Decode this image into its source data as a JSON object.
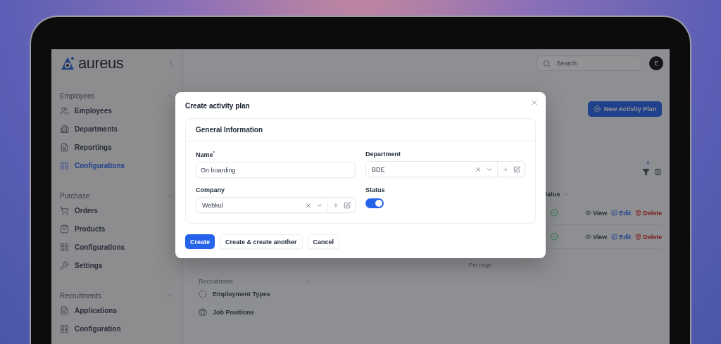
{
  "app": {
    "logo": "aureus",
    "search_placeholder": "Search",
    "avatar": "E"
  },
  "sidebar": {
    "groups": [
      {
        "title": "Employees",
        "expanded": true,
        "items": [
          {
            "label": "Employees",
            "selected": false
          },
          {
            "label": "Departments",
            "selected": false
          },
          {
            "label": "Reportings",
            "selected": false
          },
          {
            "label": "Configurations",
            "selected": true
          }
        ]
      },
      {
        "title": "Purchase",
        "expanded": true,
        "items": [
          {
            "label": "Orders",
            "selected": false
          },
          {
            "label": "Products",
            "selected": false
          },
          {
            "label": "Configurations",
            "selected": false
          },
          {
            "label": "Settings",
            "selected": false
          }
        ]
      },
      {
        "title": "Recruitments",
        "expanded": true,
        "items": [
          {
            "label": "Applications",
            "selected": false
          },
          {
            "label": "Configuration",
            "selected": false
          }
        ]
      }
    ]
  },
  "page": {
    "new_button": "New Activity Plan",
    "filter_count": "0",
    "status_header": "tatus",
    "rows": [
      {
        "view": "View",
        "edit": "Edit",
        "delete": "Delete"
      },
      {
        "view": "View",
        "edit": "Edit",
        "delete": "Delete"
      }
    ],
    "per_page": "Per page",
    "settings_group": {
      "title": "Recruitment",
      "expanded": true,
      "items": [
        "Employment Types",
        "Job Positions"
      ]
    }
  },
  "modal": {
    "title": "Create activity plan",
    "section": "General Information",
    "fields": [
      {
        "kind": "text",
        "label": "Name$^{*}$",
        "value": "On boarding"
      },
      {
        "kind": "select",
        "label": "Department",
        "value": "BDE"
      },
      {
        "kind": "select",
        "label": "Company",
        "value": "Webkul"
      },
      {
        "kind": "toggle",
        "label": "Status",
        "on": true
      }
    ],
    "buttons": [
      {
        "kind": "primary",
        "label": "Create"
      },
      {
        "kind": "secondary",
        "label": "Create & create another"
      },
      {
        "kind": "secondary",
        "label": "Cancel"
      }
    ]
  }
}
